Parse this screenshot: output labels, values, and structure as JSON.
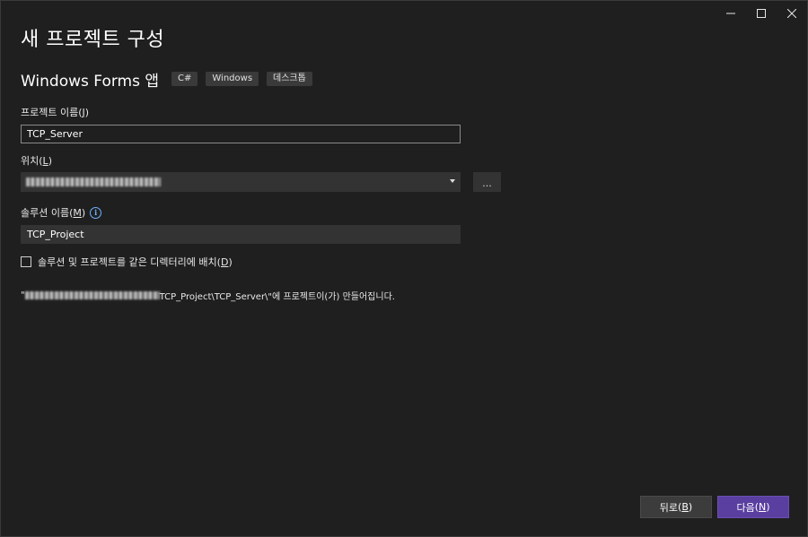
{
  "window": {
    "controls": {
      "minimize": "minimize",
      "maximize": "maximize",
      "close": "close"
    }
  },
  "page": {
    "title": "새 프로젝트 구성"
  },
  "template": {
    "name": "Windows Forms 앱",
    "tags": [
      "C#",
      "Windows",
      "데스크톱"
    ]
  },
  "project_name": {
    "label": "프로젝트 이름",
    "accelerator": "J",
    "value": "TCP_Server"
  },
  "location": {
    "label": "위치",
    "accelerator": "L",
    "browse_label": "..."
  },
  "solution_name": {
    "label": "솔루션 이름",
    "accelerator": "M",
    "value": "TCP_Project"
  },
  "same_directory": {
    "label": "솔루션 및 프로젝트를 같은 디렉터리에 배치",
    "accelerator": "D",
    "checked": false
  },
  "summary": {
    "prefix": "\"",
    "suffix": "TCP_Project\\TCP_Server\\\"에 프로젝트이(가) 만들어집니다."
  },
  "footer": {
    "back_label": "뒤로",
    "back_accelerator": "B",
    "next_label": "다음",
    "next_accelerator": "N"
  },
  "colors": {
    "background": "#1f1f1f",
    "primary_button": "#5a3fa0",
    "secondary_button": "#3c3c3c",
    "info_icon": "#6fb3ff"
  }
}
